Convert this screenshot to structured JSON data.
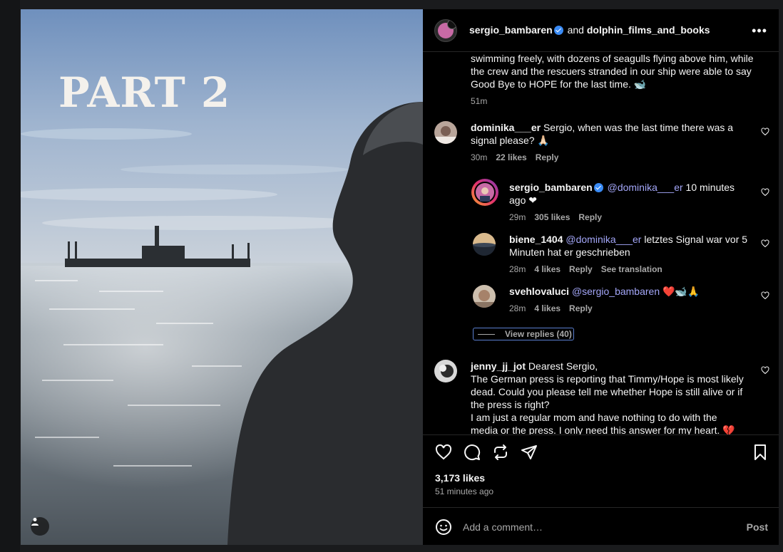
{
  "header": {
    "author": "sergio_bambaren",
    "conjunction": "and",
    "coauthor": "dolphin_films_and_books",
    "more_icon": "more-horizontal-icon"
  },
  "image": {
    "overlay_title": "PART 2",
    "tag_icon": "user-tag-icon"
  },
  "caption": {
    "text_tail": "swimming freely, with dozens of seagulls flying above him, while the crew and the rescuers stranded in our ship were able to say Good Bye to HOPE for the last time. 🐋",
    "time": "51m"
  },
  "comments": [
    {
      "user": "dominika___er",
      "text": " Sergio, when was the last time there was a signal please? 🙏🏻",
      "time": "30m",
      "likes": "22 likes",
      "reply": "Reply"
    },
    {
      "user": "sergio_bambaren",
      "mention": "@dominika___er",
      "text": " 10 minutes ago ❤",
      "time": "29m",
      "likes": "305 likes",
      "reply": "Reply"
    },
    {
      "user": "biene_1404",
      "mention": "@dominika___er",
      "text": " letztes Signal war vor 5 Minuten hat er geschrieben",
      "time": "28m",
      "likes": "4 likes",
      "reply": "Reply",
      "translate": "See translation"
    },
    {
      "user": "svehlovaluci",
      "mention": "@sergio_bambaren",
      "text": " ❤️🐋🙏",
      "time": "28m",
      "likes": "4 likes",
      "reply": "Reply"
    },
    {
      "user": "jenny_jj_jot",
      "text": " Dearest Sergio,",
      "line2": "The German press is reporting that Timmy/Hope is most likely dead. Could you please tell me whether Hope is still alive or if the press is right?",
      "line3": "I am just a regular mom and have nothing to do with the media or the press. I only need this answer for my heart. 💔"
    }
  ],
  "view_replies": "View replies (40)",
  "actions": {
    "likes": "3,173 likes",
    "posted": "51 minutes ago",
    "icons": [
      "heart-icon",
      "comment-icon",
      "repost-icon",
      "share-icon",
      "bookmark-icon"
    ]
  },
  "composer": {
    "placeholder": "Add a comment…",
    "post_label": "Post"
  },
  "colors": {
    "mention": "#a3a6f8",
    "verified": "#3a8bf5",
    "secondary_text": "#a8a8a8"
  }
}
